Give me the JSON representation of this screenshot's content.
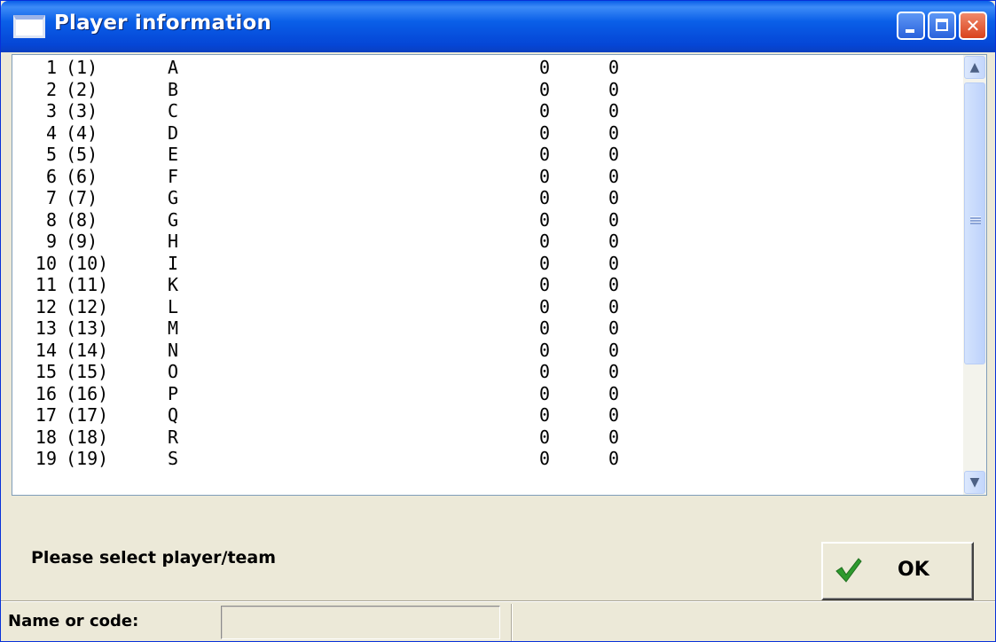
{
  "window": {
    "title": "Player information"
  },
  "players": [
    {
      "num": "1",
      "code": "(1)",
      "name": "A",
      "v1": "0",
      "v2": "0"
    },
    {
      "num": "2",
      "code": "(2)",
      "name": "B",
      "v1": "0",
      "v2": "0"
    },
    {
      "num": "3",
      "code": "(3)",
      "name": "C",
      "v1": "0",
      "v2": "0"
    },
    {
      "num": "4",
      "code": "(4)",
      "name": "D",
      "v1": "0",
      "v2": "0"
    },
    {
      "num": "5",
      "code": "(5)",
      "name": "E",
      "v1": "0",
      "v2": "0"
    },
    {
      "num": "6",
      "code": "(6)",
      "name": "F",
      "v1": "0",
      "v2": "0"
    },
    {
      "num": "7",
      "code": "(7)",
      "name": "G",
      "v1": "0",
      "v2": "0"
    },
    {
      "num": "8",
      "code": "(8)",
      "name": "G",
      "v1": "0",
      "v2": "0"
    },
    {
      "num": "9",
      "code": "(9)",
      "name": "H",
      "v1": "0",
      "v2": "0"
    },
    {
      "num": "10",
      "code": "(10)",
      "name": "I",
      "v1": "0",
      "v2": "0"
    },
    {
      "num": "11",
      "code": "(11)",
      "name": "K",
      "v1": "0",
      "v2": "0"
    },
    {
      "num": "12",
      "code": "(12)",
      "name": "L",
      "v1": "0",
      "v2": "0"
    },
    {
      "num": "13",
      "code": "(13)",
      "name": "M",
      "v1": "0",
      "v2": "0"
    },
    {
      "num": "14",
      "code": "(14)",
      "name": "N",
      "v1": "0",
      "v2": "0"
    },
    {
      "num": "15",
      "code": "(15)",
      "name": "O",
      "v1": "0",
      "v2": "0"
    },
    {
      "num": "16",
      "code": "(16)",
      "name": "P",
      "v1": "0",
      "v2": "0"
    },
    {
      "num": "17",
      "code": "(17)",
      "name": "Q",
      "v1": "0",
      "v2": "0"
    },
    {
      "num": "18",
      "code": "(18)",
      "name": "R",
      "v1": "0",
      "v2": "0"
    },
    {
      "num": "19",
      "code": "(19)",
      "name": "S",
      "v1": "0",
      "v2": "0"
    }
  ],
  "prompt": "Please select player/team",
  "ok_button": {
    "label": "OK",
    "icon": "checkmark-icon",
    "icon_color": "#2e9a2e"
  },
  "status_bar": {
    "name_label": "Name or code:",
    "name_value": ""
  },
  "colors": {
    "titlebar": "#0a5fe8",
    "dialog_bg": "#ece9d8",
    "close_button": "#d9421c"
  }
}
